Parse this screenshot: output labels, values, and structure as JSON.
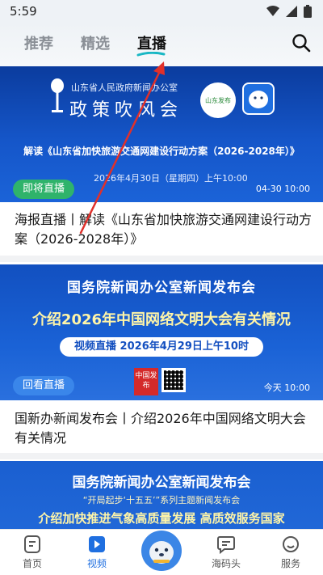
{
  "status": {
    "time": "5:59"
  },
  "tabs": [
    {
      "label": "推荐"
    },
    {
      "label": "精选"
    },
    {
      "label": "直播"
    }
  ],
  "feed": {
    "items": [
      {
        "banner": {
          "org": "山东省人民政府新闻办公室",
          "title": "政策吹风会",
          "logo_text": "山东发布",
          "subtitle": "解读《山东省加快旅游交通网建设行动方案（2026-2028年）》",
          "date": "2026年4月30日（星期四）上午10:00"
        },
        "badge": "即将直播",
        "time": "04-30 10:00",
        "caption": "海报直播丨解读《山东省加快旅游交通网建设行动方案（2026-2028年）》"
      },
      {
        "banner": {
          "org": "国务院新闻办公室新闻发布会",
          "title": "介绍2026年中国网络文明大会有关情况",
          "live_line": "视频直播 2026年4月29日上午10时",
          "brand": "中国发布"
        },
        "badge": "回看直播",
        "time": "今天 10:00",
        "caption": "国新办新闻发布会丨介绍2026年中国网络文明大会有关情况"
      },
      {
        "banner": {
          "org": "国务院新闻办公室新闻发布会",
          "subtitle": "“开局起步‘十五五’”系列主题新闻发布会",
          "title": "介绍加快推进气象高质量发展 高质效服务国家"
        }
      }
    ]
  },
  "bottom_nav": [
    {
      "label": "首页",
      "icon": "home-icon"
    },
    {
      "label": "视频",
      "icon": "video-icon"
    },
    {
      "label": "",
      "icon": "mascot-icon"
    },
    {
      "label": "海码头",
      "icon": "chat-icon"
    },
    {
      "label": "服务",
      "icon": "service-icon"
    }
  ],
  "colors": {
    "accent": "#1f6fe0",
    "live_green": "#2fb36b",
    "annotation_red": "#e0302a"
  }
}
